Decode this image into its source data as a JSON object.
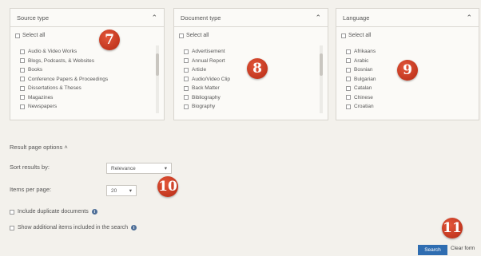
{
  "panels": [
    {
      "title": "Source type",
      "select_all": "Select all",
      "items": [
        "Audio & Video Works",
        "Blogs, Podcasts, & Websites",
        "Books",
        "Conference Papers & Proceedings",
        "Dissertations & Theses",
        "Magazines",
        "Newspapers"
      ]
    },
    {
      "title": "Document type",
      "select_all": "Select all",
      "items": [
        "Advertisement",
        "Annual Report",
        "Article",
        "Audio/Video Clip",
        "Back Matter",
        "Bibliography",
        "Biography"
      ]
    },
    {
      "title": "Language",
      "select_all": "Select all",
      "items": [
        "Afrikaans",
        "Arabic",
        "Bosnian",
        "Bulgarian",
        "Catalan",
        "Chinese",
        "Croatian"
      ]
    }
  ],
  "callouts": [
    "7",
    "8",
    "9",
    "10",
    "11"
  ],
  "result_options": {
    "heading": "Result page options",
    "sort_label": "Sort results by:",
    "sort_value": "Relevance",
    "items_label": "Items per page:",
    "items_value": "20",
    "include_duplicates": "Include duplicate documents",
    "show_additional": "Show additional items included in the search"
  },
  "actions": {
    "search": "Search",
    "clear": "Clear form"
  },
  "colors": {
    "background": "#f3f1ec",
    "primary_button": "#2f6db1",
    "callout": "#c0341c"
  }
}
